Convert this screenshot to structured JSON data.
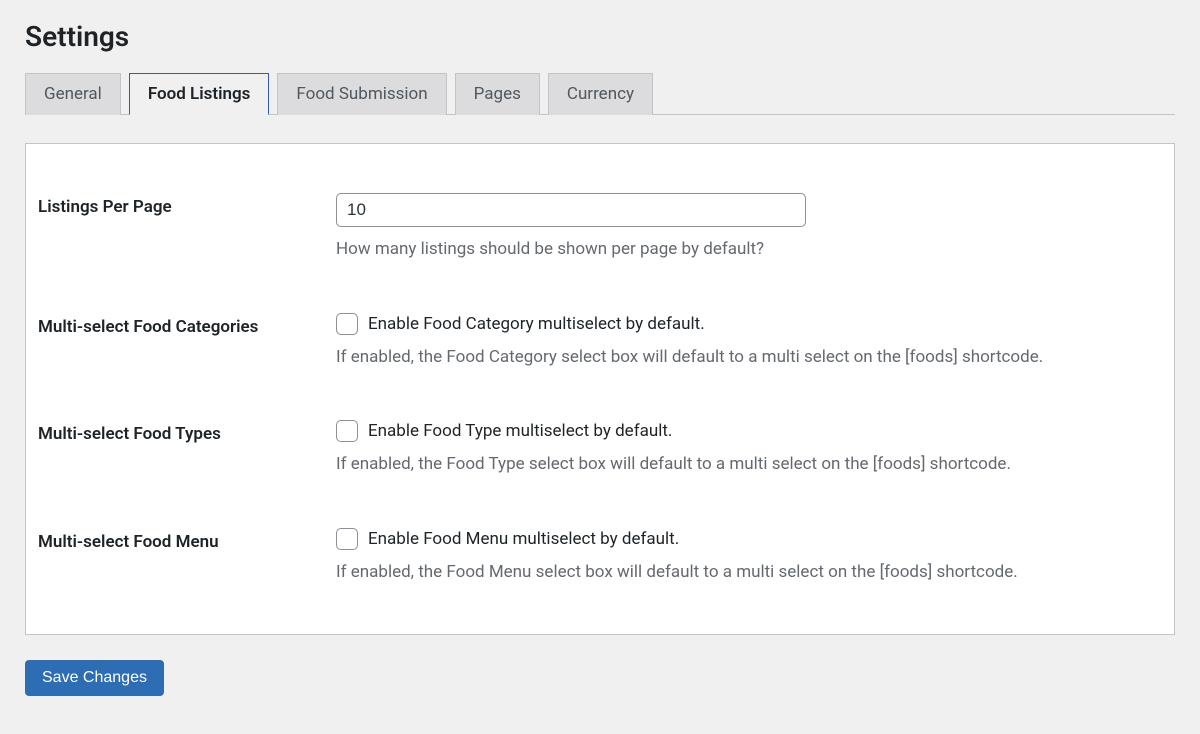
{
  "page": {
    "title": "Settings"
  },
  "tabs": [
    {
      "label": "General",
      "active": false
    },
    {
      "label": "Food Listings",
      "active": true
    },
    {
      "label": "Food Submission",
      "active": false
    },
    {
      "label": "Pages",
      "active": false
    },
    {
      "label": "Currency",
      "active": false
    }
  ],
  "fields": {
    "listings_per_page": {
      "label": "Listings Per Page",
      "value": "10",
      "help": "How many listings should be shown per page by default?"
    },
    "multi_categories": {
      "label": "Multi-select Food Categories",
      "checkbox_label": "Enable Food Category multiselect by default.",
      "help": "If enabled, the Food Category select box will default to a multi select on the [foods] shortcode.",
      "checked": false
    },
    "multi_types": {
      "label": "Multi-select Food Types",
      "checkbox_label": "Enable Food Type multiselect by default.",
      "help": "If enabled, the Food Type select box will default to a multi select on the [foods] shortcode.",
      "checked": false
    },
    "multi_menu": {
      "label": "Multi-select Food Menu",
      "checkbox_label": "Enable Food Menu multiselect by default.",
      "help": "If enabled, the Food Menu select box will default to a multi select on the [foods] shortcode.",
      "checked": false
    }
  },
  "actions": {
    "save_label": "Save Changes"
  }
}
